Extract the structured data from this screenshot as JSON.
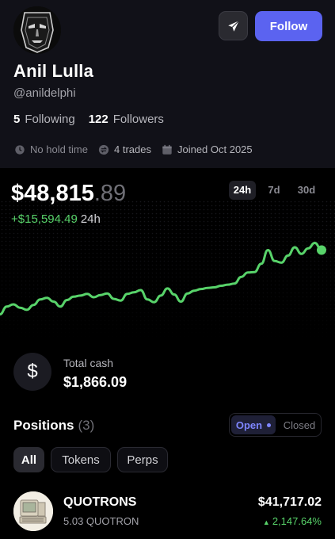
{
  "profile": {
    "name": "Anil Lulla",
    "handle": "@anildelphi",
    "follow_label": "Follow",
    "following_count": "5",
    "following_label": "Following",
    "followers_count": "122",
    "followers_label": "Followers",
    "meta": {
      "hold_time": "No hold time",
      "trades": "4 trades",
      "joined": "Joined Oct 2025"
    }
  },
  "portfolio": {
    "value_main": "$48,815",
    "value_cents": ".89",
    "change": "+$15,594.49",
    "change_period": "24h",
    "ranges": [
      "24h",
      "7d",
      "30d"
    ],
    "active_range": "24h"
  },
  "chart_data": {
    "type": "line",
    "series": [
      {
        "values": [
          48,
          62,
          66,
          60,
          56,
          65,
          75,
          78,
          71,
          62,
          74,
          80,
          82,
          85,
          79,
          83,
          86,
          76,
          73,
          85,
          88,
          92,
          75,
          70,
          82,
          95,
          84,
          71,
          86,
          91,
          94,
          96,
          97,
          100,
          102,
          104,
          116,
          124,
          125,
          140,
          165,
          145,
          142,
          155,
          170,
          158,
          168,
          178,
          165
        ]
      }
    ],
    "color": "#58d36a"
  },
  "cash": {
    "label": "Total cash",
    "value": "$1,866.09",
    "icon": "dollar-icon"
  },
  "positions": {
    "title": "Positions",
    "count": "(3)",
    "toggle_open": "Open",
    "toggle_closed": "Closed",
    "filters": [
      "All",
      "Tokens",
      "Perps"
    ],
    "items": [
      {
        "name": "QUOTRONS",
        "amount": "5.03 QUOTRON",
        "value": "$41,717.02",
        "change": "2,147.64%",
        "change_arrow": "▲"
      }
    ]
  },
  "colors": {
    "accent": "#5b63f0",
    "positive": "#58d36a",
    "background": "#000000",
    "profile_bg": "#111118"
  }
}
